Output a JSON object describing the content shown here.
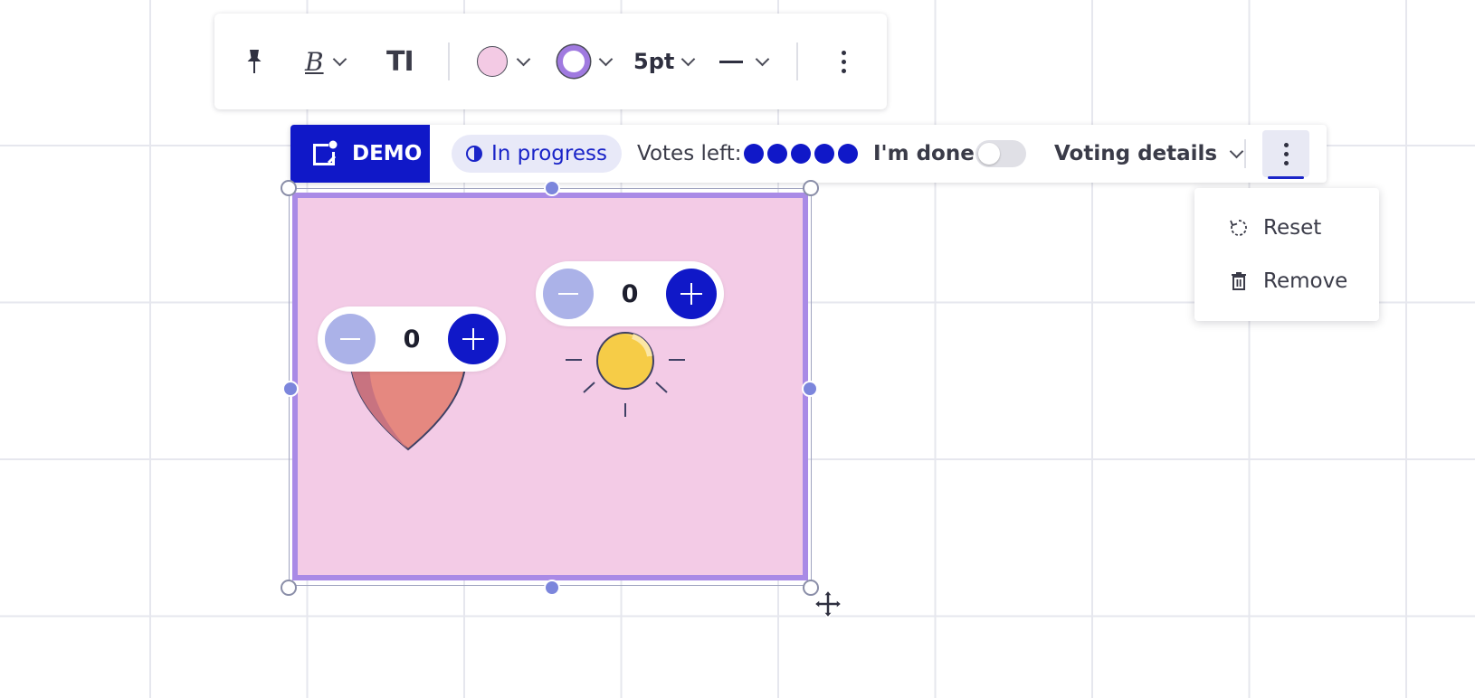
{
  "toolbar": {
    "items": [
      "pin",
      "bold",
      "text-size",
      "fill-color",
      "border-color",
      "border-width",
      "line-style",
      "more"
    ],
    "bold_glyph": "B",
    "text_size_glyph": "TI",
    "border_width": "5pt",
    "fill_color": "#f3cae4",
    "border_color": "#a07ae0"
  },
  "vote_bar": {
    "badge": "DEMO",
    "status": "In progress",
    "votes_left_label": "Votes left:",
    "votes_remaining": 5,
    "done_label": "I'm done",
    "done_toggle": false,
    "details_label": "Voting details",
    "accent": "#1018c8"
  },
  "menu": {
    "items": [
      {
        "label": "Reset",
        "icon": "reset-icon"
      },
      {
        "label": "Remove",
        "icon": "trash-icon"
      }
    ]
  },
  "frame": {
    "fill": "#f3cbe6",
    "border": "#a98ae6",
    "stickers": [
      {
        "name": "heart",
        "votes": "0"
      },
      {
        "name": "sun",
        "votes": "0"
      }
    ]
  }
}
